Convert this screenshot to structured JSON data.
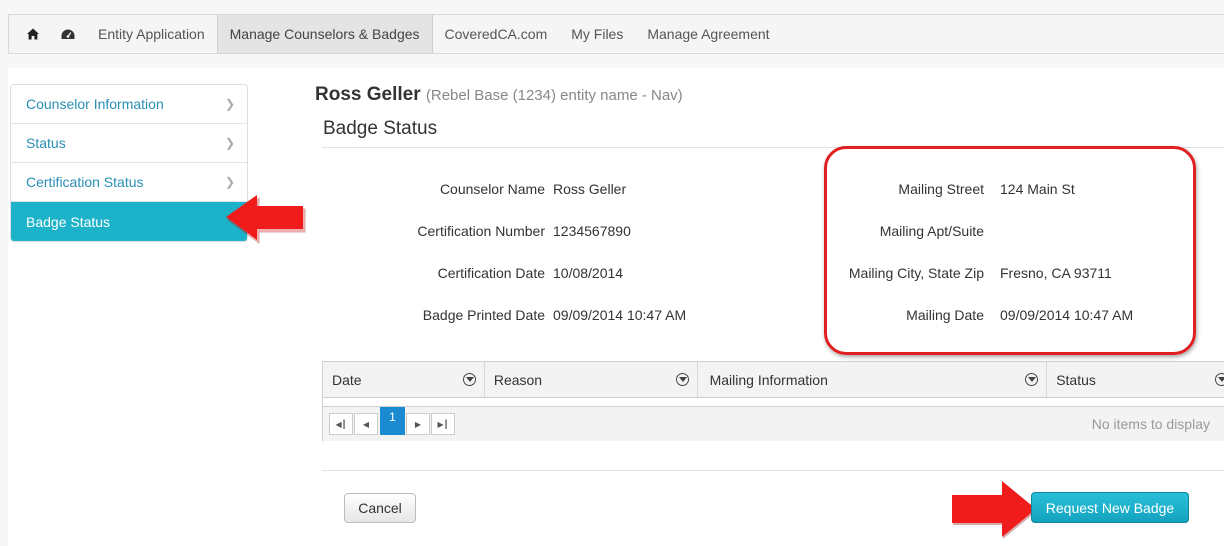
{
  "nav": {
    "items": [
      "Entity Application",
      "Manage Counselors & Badges",
      "CoveredCA.com",
      "My Files",
      "Manage Agreement"
    ],
    "active": "Manage Counselors & Badges"
  },
  "sidebar": {
    "items": [
      {
        "label": "Counselor Information"
      },
      {
        "label": "Status"
      },
      {
        "label": "Certification Status"
      },
      {
        "label": "Badge Status"
      }
    ],
    "active": "Badge Status"
  },
  "header": {
    "name": "Ross Geller",
    "subtitle": "(Rebel Base (1234) entity name - Nav)",
    "section": "Badge Status"
  },
  "details_left": [
    {
      "label": "Counselor Name",
      "value": "Ross Geller"
    },
    {
      "label": "Certification Number",
      "value": "1234567890"
    },
    {
      "label": "Certification Date",
      "value": "10/08/2014"
    },
    {
      "label": "Badge Printed Date",
      "value": "09/09/2014 10:47 AM"
    }
  ],
  "details_right": [
    {
      "label": "Mailing Street",
      "value": "124 Main St"
    },
    {
      "label": "Mailing Apt/Suite",
      "value": ""
    },
    {
      "label": "Mailing City, State Zip",
      "value": "Fresno, CA 93711"
    },
    {
      "label": "Mailing Date",
      "value": "09/09/2014 10:47 AM"
    }
  ],
  "grid": {
    "columns": [
      "Date",
      "Reason",
      "Mailing Information",
      "Status"
    ],
    "page": "1",
    "empty_text": "No items to display"
  },
  "buttons": {
    "cancel": "Cancel",
    "request": "Request New Badge"
  },
  "colors": {
    "accent": "#1cb2c9",
    "link": "#2a8fb6",
    "annotation": "#e02020"
  }
}
